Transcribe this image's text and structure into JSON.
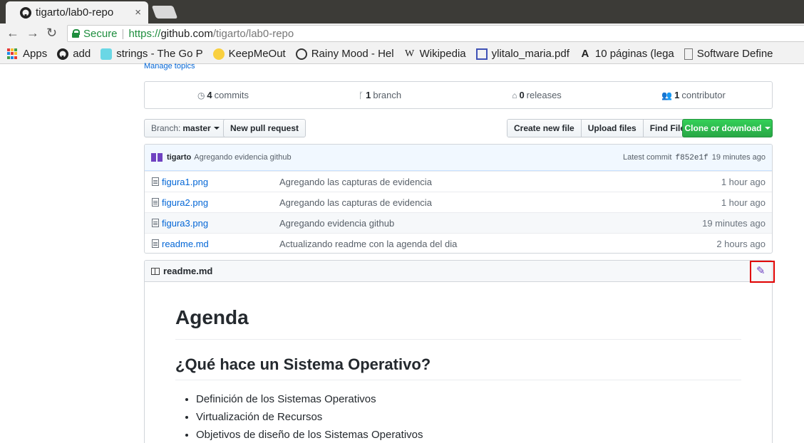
{
  "browser": {
    "tab_title": "tigarto/lab0-repo",
    "tab_close": "×",
    "secure_label": "Secure",
    "url_scheme": "https://",
    "url_host": "github.com",
    "url_path": "/tigarto/lab0-repo"
  },
  "bookmarks": [
    {
      "icon": "apps-icon",
      "label": "Apps"
    },
    {
      "icon": "github-icon",
      "label": "add"
    },
    {
      "icon": "gopher-icon",
      "label": "strings - The Go P"
    },
    {
      "icon": "smiley-icon",
      "label": "KeepMeOut"
    },
    {
      "icon": "raindrop-icon",
      "label": "Rainy Mood - Hel"
    },
    {
      "icon": "wikipedia-icon",
      "label": "Wikipedia"
    },
    {
      "icon": "document-icon",
      "label": "ylitalo_maria.pdf"
    },
    {
      "icon": "letter-a-icon",
      "label": "10 páginas (lega"
    },
    {
      "icon": "page-icon",
      "label": "Software Define"
    }
  ],
  "repo": {
    "manage_topics": "Manage topics",
    "summary": {
      "commits_count": "4",
      "commits_label": "commits",
      "branch_count": "1",
      "branch_label": "branch",
      "releases_count": "0",
      "releases_label": "releases",
      "contributor_count": "1",
      "contributor_label": "contributor"
    },
    "branch_prefix": "Branch:",
    "branch_name": "master",
    "new_pull_request": "New pull request",
    "create_new_file": "Create new file",
    "upload_files": "Upload files",
    "find_file": "Find File",
    "clone_or_download": "Clone or download",
    "latest_commit": {
      "author": "tigarto",
      "message": "Agregando evidencia github",
      "prefix": "Latest commit",
      "sha": "f852e1f",
      "age": "19 minutes ago"
    },
    "files": [
      {
        "name": "figura1.png",
        "commit": "Agregando las capturas de evidencia",
        "age": "1 hour ago"
      },
      {
        "name": "figura2.png",
        "commit": "Agregando las capturas de evidencia",
        "age": "1 hour ago"
      },
      {
        "name": "figura3.png",
        "commit": "Agregando evidencia github",
        "age": "19 minutes ago"
      },
      {
        "name": "readme.md",
        "commit": "Actualizando readme con la agenda del dia",
        "age": "2 hours ago"
      }
    ],
    "readme": {
      "filename": "readme.md",
      "h1": "Agenda",
      "h2": "¿Qué hace un Sistema Operativo?",
      "items": [
        "Definición de los Sistemas Operativos",
        "Virtualización de Recursos",
        "Objetivos de diseño de los Sistemas Operativos"
      ]
    }
  }
}
